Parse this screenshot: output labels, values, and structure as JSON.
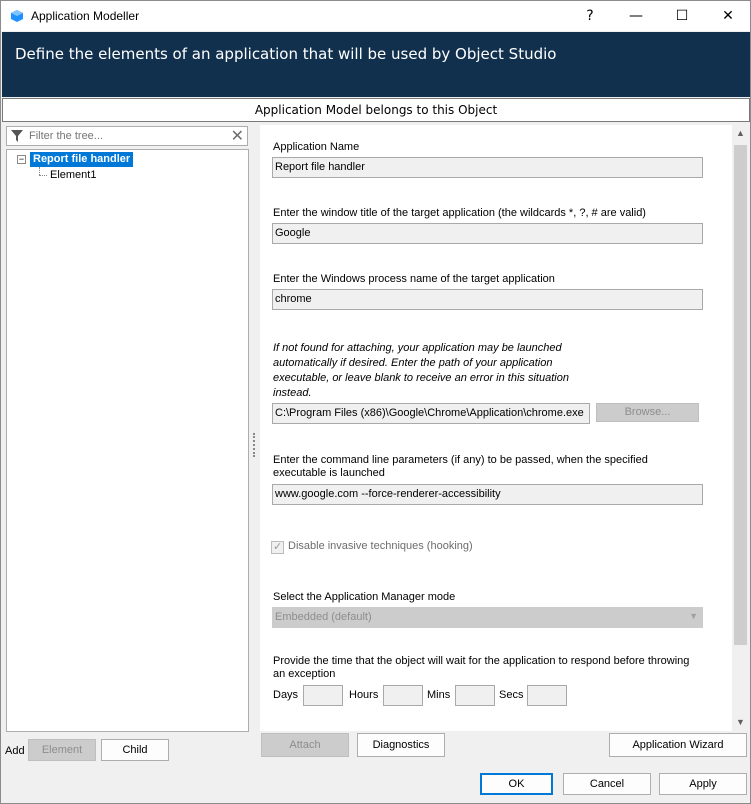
{
  "window": {
    "title": "Application Modeller",
    "help_glyph": "?",
    "minimize_glyph": "—",
    "maximize_glyph": "☐",
    "close_glyph": "✕"
  },
  "banner": {
    "text": "Define the elements of an application that will be used by Object Studio"
  },
  "belongs_bar": {
    "text": "Application Model belongs to this Object"
  },
  "tree": {
    "filter_placeholder": "Filter the tree...",
    "expander_glyph": "−",
    "root": "Report file handler",
    "children": [
      "Element1"
    ]
  },
  "add_bar": {
    "label": "Add",
    "element_button": "Element",
    "child_button": "Child"
  },
  "form": {
    "app_name_label": "Application Name",
    "app_name_value": "Report file handler",
    "window_title_label": "Enter the window title of the target application (the wildcards *, ?, # are valid)",
    "window_title_value": "Google",
    "process_label": "Enter the Windows process name of the target application",
    "process_value": "chrome",
    "launch_hint": [
      "If not found for attaching, your application may be launched",
      "automatically if desired. Enter the path of your application",
      "executable, or leave blank to receive an error in this situation",
      "instead."
    ],
    "path_value": "C:\\Program Files (x86)\\Google\\Chrome\\Application\\chrome.exe",
    "browse_button": "Browse...",
    "params_label": [
      "Enter the command line parameters (if any) to be passed, when the specified",
      "executable is launched"
    ],
    "params_value": "www.google.com --force-renderer-accessibility",
    "disable_invasive_label": "Disable invasive techniques (hooking)",
    "disable_invasive_checked": true,
    "manager_mode_label": "Select the Application Manager mode",
    "manager_mode_value": "Embedded (default)",
    "timeout_label": [
      "Provide the time that the object will wait for the application to respond before throwing",
      "an exception"
    ],
    "days_label": "Days",
    "hours_label": "Hours",
    "mins_label": "Mins",
    "secs_label": "Secs"
  },
  "actions": {
    "attach": "Attach",
    "diagnostics": "Diagnostics",
    "wizard": "Application Wizard",
    "ok": "OK",
    "cancel": "Cancel",
    "apply": "Apply"
  },
  "colors": {
    "banner": "#11304d",
    "selection": "#0078d7"
  }
}
